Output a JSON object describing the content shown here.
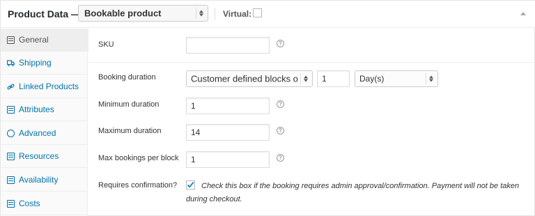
{
  "header": {
    "title": "Product Data —",
    "product_type": "Bookable product",
    "virtual_label": "Virtual:",
    "virtual_checked": false
  },
  "sidebar": {
    "items": [
      {
        "label": "General",
        "icon": "general-icon",
        "active": true
      },
      {
        "label": "Shipping",
        "icon": "truck-icon",
        "active": false
      },
      {
        "label": "Linked Products",
        "icon": "link-icon",
        "active": false
      },
      {
        "label": "Attributes",
        "icon": "list-icon",
        "active": false
      },
      {
        "label": "Advanced",
        "icon": "gear-icon",
        "active": false
      },
      {
        "label": "Resources",
        "icon": "calendar-icon",
        "active": false
      },
      {
        "label": "Availability",
        "icon": "calendar-icon",
        "active": false
      },
      {
        "label": "Costs",
        "icon": "calendar-icon",
        "active": false
      }
    ]
  },
  "form": {
    "sku": {
      "label": "SKU",
      "value": ""
    },
    "booking_duration": {
      "label": "Booking duration",
      "type_value": "Customer defined blocks of",
      "amount": "1",
      "unit": "Day(s)"
    },
    "min_duration": {
      "label": "Minimum duration",
      "value": "1"
    },
    "max_duration": {
      "label": "Maximum duration",
      "value": "14"
    },
    "max_bookings": {
      "label": "Max bookings per block",
      "value": "1"
    },
    "requires_confirmation": {
      "label": "Requires confirmation?",
      "checked": true,
      "description_line1": "Check this box if the booking requires admin approval/confirmation. Payment will not be taken",
      "description_line2": "during checkout."
    }
  },
  "colors": {
    "accent": "#0073aa",
    "check": "#1e8cbe"
  }
}
